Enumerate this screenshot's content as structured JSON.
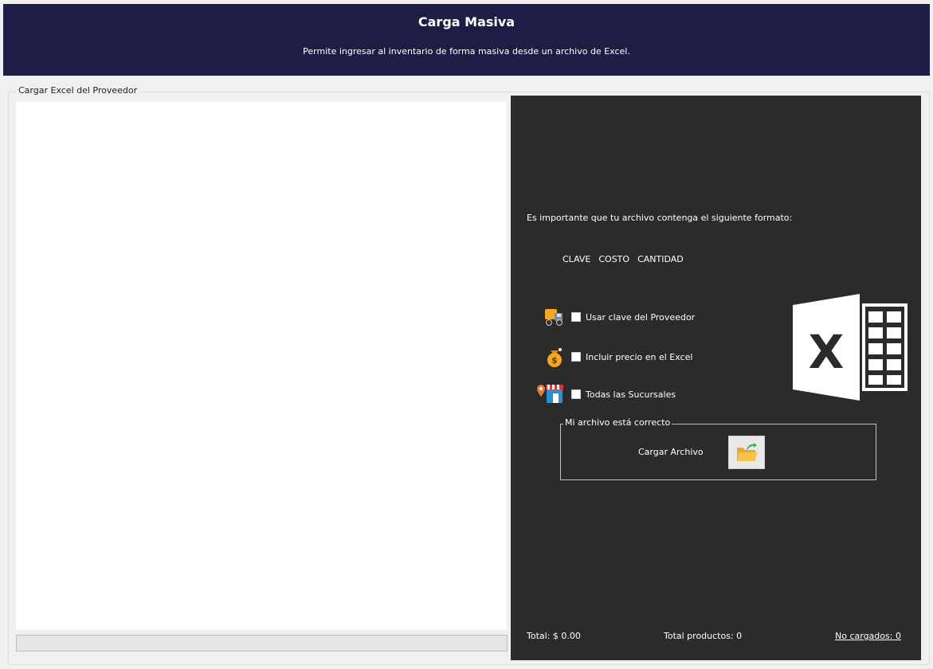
{
  "header": {
    "title": "Carga Masiva",
    "subtitle": "Permite ingresar al inventario de forma masiva desde un archivo de Excel."
  },
  "group": {
    "legend": "Cargar Excel del Proveedor"
  },
  "progress": {
    "value": 0
  },
  "panel": {
    "format_note": "Es importante que tu archivo contenga el siguiente formato:",
    "columns": [
      "CLAVE",
      "COSTO",
      "CANTIDAD"
    ],
    "options": [
      {
        "label": "Usar clave del Proveedor",
        "icon": "delivery-truck-icon",
        "checked": false
      },
      {
        "label": "Incluir precio en el Excel",
        "icon": "money-bag-icon",
        "checked": false
      },
      {
        "label": "Todas las Sucursales",
        "icon": "store-location-icon",
        "checked": false
      }
    ],
    "file_group": {
      "legend": "Mi archivo está correcto",
      "load_label": "Cargar Archivo",
      "load_icon": "open-folder-icon"
    },
    "logo_icon": "excel-logo-icon",
    "footer": {
      "total": "Total: $ 0.00",
      "products": "Total productos: 0",
      "not_loaded": "No cargados: 0"
    }
  },
  "colors": {
    "header_bg": "#1e1d45",
    "panel_bg": "#2b2b2b",
    "accent_orange": "#f0a020"
  }
}
